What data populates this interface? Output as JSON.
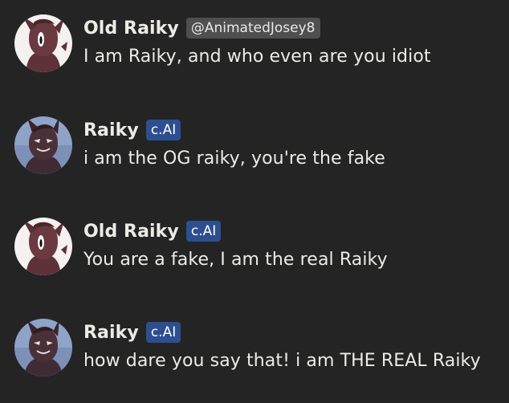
{
  "messages": [
    {
      "author": "Old Raiky",
      "tag": "@AnimatedJosey8",
      "tag_type": "user",
      "avatar": "old-raiky",
      "text": "I am Raiky, and who even are you idiot"
    },
    {
      "author": "Raiky",
      "tag": "c.AI",
      "tag_type": "ai",
      "avatar": "raiky",
      "text": "i am the OG raiky, you're the fake"
    },
    {
      "author": "Old Raiky",
      "tag": "c.AI",
      "tag_type": "ai",
      "avatar": "old-raiky",
      "text": "You are a fake, I am the real Raiky"
    },
    {
      "author": "Raiky",
      "tag": "c.AI",
      "tag_type": "ai",
      "avatar": "raiky",
      "text": "how dare you say that! i am THE REAL Raiky"
    }
  ],
  "colors": {
    "background": "#242424",
    "text": "#ecebe6",
    "user_tag_bg": "#4f4f4f",
    "ai_tag_bg": "#2d4f90"
  }
}
